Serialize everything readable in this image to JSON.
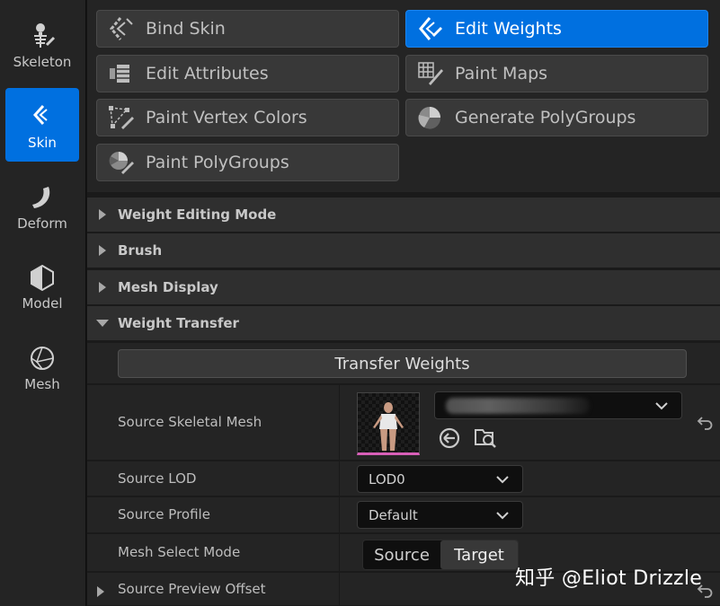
{
  "rail": {
    "items": [
      {
        "label": "Skeleton",
        "icon": "skeleton-icon",
        "active": false
      },
      {
        "label": "Skin",
        "icon": "skin-icon",
        "active": true
      },
      {
        "label": "Deform",
        "icon": "deform-icon",
        "active": false
      },
      {
        "label": "Model",
        "icon": "model-icon",
        "active": false
      },
      {
        "label": "Mesh",
        "icon": "mesh-icon",
        "active": false
      }
    ]
  },
  "tools": {
    "items": [
      {
        "label": "Bind Skin",
        "icon": "bind-skin-icon",
        "active": false
      },
      {
        "label": "Edit Weights",
        "icon": "edit-weights-icon",
        "active": true
      },
      {
        "label": "Edit Attributes",
        "icon": "edit-attributes-icon",
        "active": false
      },
      {
        "label": "Paint Maps",
        "icon": "paint-maps-icon",
        "active": false
      },
      {
        "label": "Paint Vertex Colors",
        "icon": "paint-vertex-colors-icon",
        "active": false
      },
      {
        "label": "Generate PolyGroups",
        "icon": "generate-polygroups-icon",
        "active": false
      },
      {
        "label": "Paint PolyGroups",
        "icon": "paint-polygroups-icon",
        "active": false
      }
    ]
  },
  "sections": {
    "items": [
      {
        "label": "Weight Editing Mode",
        "expanded": false
      },
      {
        "label": "Brush",
        "expanded": false
      },
      {
        "label": "Mesh Display",
        "expanded": false
      },
      {
        "label": "Weight Transfer",
        "expanded": true
      }
    ]
  },
  "transfer": {
    "button_label": "Transfer Weights",
    "source_skeletal_mesh": {
      "label": "Source Skeletal Mesh"
    },
    "source_lod": {
      "label": "Source LOD",
      "value": "LOD0"
    },
    "source_profile": {
      "label": "Source Profile",
      "value": "Default"
    },
    "mesh_select_mode": {
      "label": "Mesh Select Mode",
      "options": [
        "Source",
        "Target"
      ],
      "selected": "Target"
    },
    "source_preview_offset": {
      "label": "Source Preview Offset"
    }
  },
  "watermark": "知乎 @Eliot Drizzle",
  "colors": {
    "accent": "#0070e0",
    "panel": "#242424",
    "button": "#383838",
    "thumbnail_underline": "#d85fb8"
  }
}
